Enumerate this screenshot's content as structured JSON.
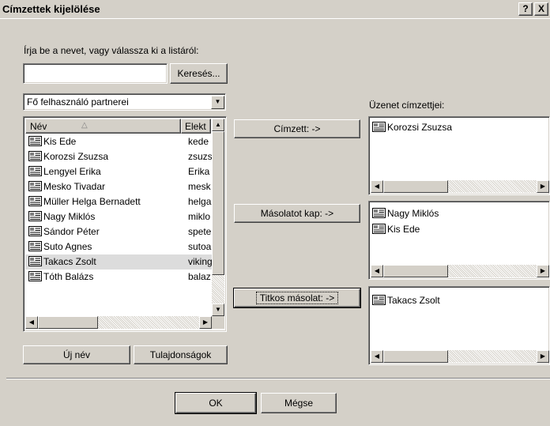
{
  "window": {
    "title": "Címzettek kijelölése",
    "help_label": "?",
    "close_label": "X"
  },
  "search": {
    "prompt": "Írja be a nevet, vagy válassza ki a listáról:",
    "value": "",
    "button_label": "Keresés..."
  },
  "address_book": {
    "selected": "Fő felhasználó partnerei",
    "columns": {
      "name": "Név",
      "email": "Elekt"
    },
    "rows": [
      {
        "name": "Kis Ede",
        "email": "kede"
      },
      {
        "name": "Korozsi Zsuzsa",
        "email": "zsuzs"
      },
      {
        "name": "Lengyel Erika",
        "email": "Erika"
      },
      {
        "name": "Mesko Tivadar",
        "email": "mesk"
      },
      {
        "name": "Müller Helga Bernadett",
        "email": "helga"
      },
      {
        "name": "Nagy Miklós",
        "email": "miklo"
      },
      {
        "name": "Sándor Péter",
        "email": "spete"
      },
      {
        "name": "Suto Agnes",
        "email": "sutoa"
      },
      {
        "name": "Takacs Zsolt",
        "email": "viking"
      },
      {
        "name": "Tóth Balázs",
        "email": "balaz"
      }
    ]
  },
  "actions": {
    "new_name": "Új név",
    "properties": "Tulajdonságok",
    "to": "Címzett: ->",
    "cc": "Másolatot kap: ->",
    "bcc": "Titkos másolat: ->"
  },
  "recipients": {
    "label": "Üzenet címzettjei:",
    "to": [
      "Korozsi Zsuzsa"
    ],
    "cc": [
      "Nagy Miklós",
      "Kis Ede"
    ],
    "bcc": [
      "Takacs Zsolt"
    ]
  },
  "footer": {
    "ok": "OK",
    "cancel": "Mégse"
  },
  "colors": {
    "face": "#d4d0c8",
    "highlight_row": "#dcdcdc"
  }
}
